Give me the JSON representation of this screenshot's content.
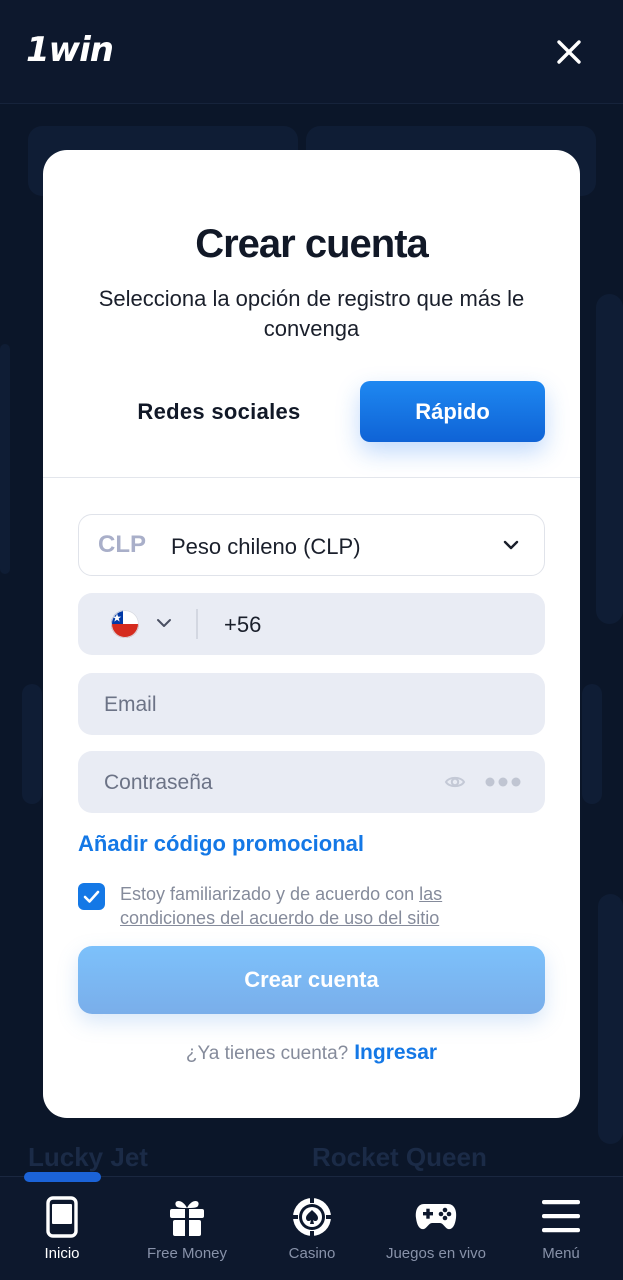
{
  "header": {
    "logo": "1win",
    "close_icon": "close-icon"
  },
  "background": {
    "card_titles": [
      "Lucky Jet",
      "Rocket Queen"
    ]
  },
  "modal": {
    "title": "Crear cuenta",
    "subtitle": "Selecciona la opción de registro que más le convenga",
    "tabs": [
      {
        "label": "Redes sociales",
        "active": false
      },
      {
        "label": "Rápido",
        "active": true
      }
    ],
    "currency": {
      "code": "CLP",
      "name": "Peso chileno (CLP)"
    },
    "phone": {
      "country_flag": "chile-flag-icon",
      "value": "+56"
    },
    "email": {
      "placeholder": "Email"
    },
    "password": {
      "placeholder": "Contraseña"
    },
    "promo_link": "Añadir código promocional",
    "terms": {
      "checked": true,
      "text": "Estoy familiarizado y de acuerdo con ",
      "link": "las condiciones del acuerdo de uso del sitio"
    },
    "submit_label": "Crear cuenta",
    "login_prompt": "¿Ya tienes cuenta?",
    "login_link": "Ingresar"
  },
  "bottom_nav": {
    "items": [
      {
        "label": "Inicio",
        "icon": "phone-icon",
        "active": true
      },
      {
        "label": "Free Money",
        "icon": "gift-icon",
        "active": false
      },
      {
        "label": "Casino",
        "icon": "casino-chip-icon",
        "active": false
      },
      {
        "label": "Juegos en vivo",
        "icon": "gamepad-icon",
        "active": false
      },
      {
        "label": "Menú",
        "icon": "menu-icon",
        "active": false
      }
    ]
  },
  "colors": {
    "accent": "#1478e6",
    "background": "#0b1629",
    "modal": "#ffffff",
    "submit": "#7ab7f2"
  }
}
